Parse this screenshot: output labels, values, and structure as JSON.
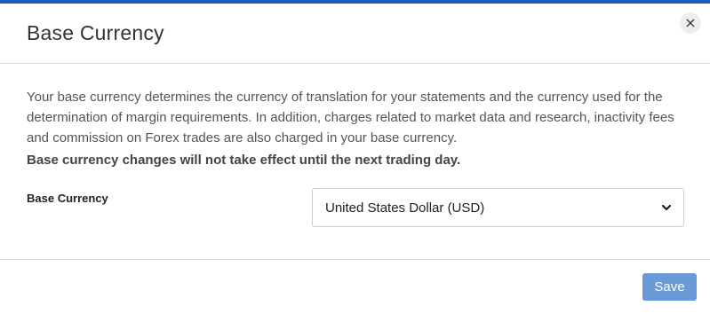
{
  "dialog": {
    "title": "Base Currency",
    "close_label": "×",
    "description": "Your base currency determines the currency of translation for your statements and the currency used for the determination of margin requirements. In addition, charges related to market data and research, inactivity fees and commission on Forex trades are also charged in your base currency.",
    "note": "Base currency changes will not take effect until the next trading day.",
    "field_label": "Base Currency",
    "selected_currency": "United States Dollar (USD)",
    "save_label": "Save"
  },
  "colors": {
    "accent_top": "#1a5cbf",
    "save_button": "#6a9bd8"
  },
  "icons": {
    "close": "close-icon",
    "dropdown": "chevron-down-icon"
  }
}
